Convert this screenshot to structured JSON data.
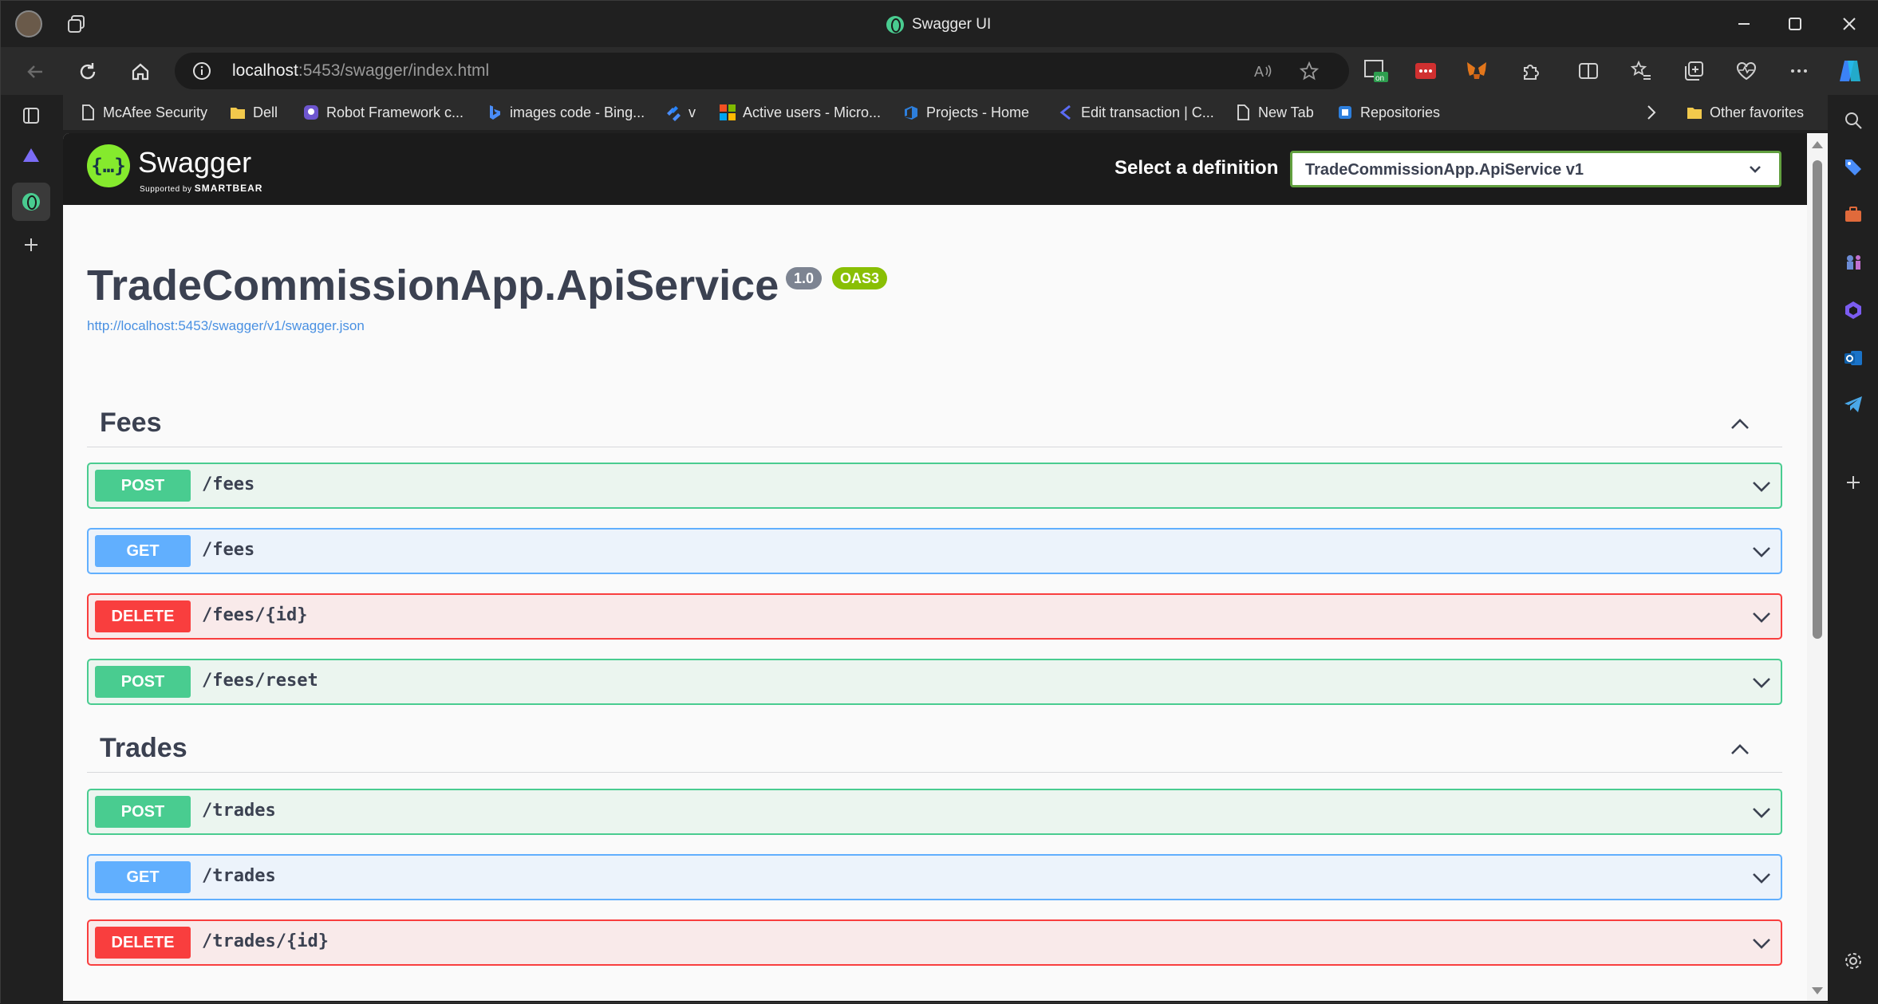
{
  "window": {
    "title": "Swagger UI"
  },
  "address_bar": {
    "host": "localhost",
    "rest": ":5453/swagger/index.html"
  },
  "favorites": [
    {
      "label": "McAfee Security",
      "icon": "page-icon"
    },
    {
      "label": "Dell",
      "icon": "folder-icon"
    },
    {
      "label": "Robot Framework c...",
      "icon": "robot-icon"
    },
    {
      "label": "images code - Bing...",
      "icon": "bing-icon"
    },
    {
      "label": "v",
      "icon": "jira-icon"
    },
    {
      "label": "Active users - Micro...",
      "icon": "microsoft-icon"
    },
    {
      "label": "Projects - Home",
      "icon": "azure-devops-icon"
    },
    {
      "label": "Edit transaction | C...",
      "icon": "app-icon"
    },
    {
      "label": "New Tab",
      "icon": "page-icon"
    },
    {
      "label": "Repositories",
      "icon": "repo-icon"
    },
    {
      "label": "Other favorites",
      "icon": "folder-icon"
    }
  ],
  "swagger": {
    "brand": "Swagger",
    "supported_by": "Supported by",
    "smartbear": "SMARTBEAR",
    "definition_label": "Select a definition",
    "definition_value": "TradeCommissionApp.ApiService v1"
  },
  "info": {
    "title": "TradeCommissionApp.ApiService",
    "version": "1.0",
    "oas": "OAS3",
    "spec_url": "http://localhost:5453/swagger/v1/swagger.json"
  },
  "tags": [
    {
      "name": "Fees",
      "operations": [
        {
          "method": "POST",
          "path": "/fees"
        },
        {
          "method": "GET",
          "path": "/fees"
        },
        {
          "method": "DELETE",
          "path": "/fees/{id}"
        },
        {
          "method": "POST",
          "path": "/fees/reset"
        }
      ]
    },
    {
      "name": "Trades",
      "operations": [
        {
          "method": "POST",
          "path": "/trades"
        },
        {
          "method": "GET",
          "path": "/trades"
        },
        {
          "method": "DELETE",
          "path": "/trades/{id}"
        }
      ]
    }
  ],
  "colors": {
    "post": "#49cc90",
    "get": "#61affe",
    "delete": "#f93e3e",
    "swagger_green": "#85ea2d"
  }
}
